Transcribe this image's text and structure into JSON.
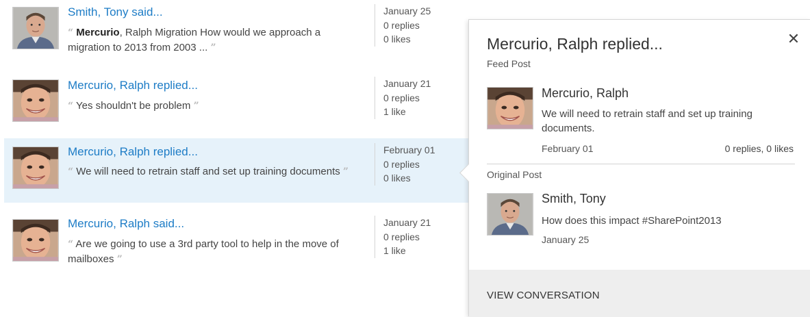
{
  "feed": {
    "items": [
      {
        "title": "Smith, Tony said...",
        "quote_prefix_bold": "Mercurio",
        "quote_text": ", Ralph Migration How would we approach a migration to 2013 from 2003 ...",
        "date": "January 25",
        "replies": "0 replies",
        "likes": "0 likes",
        "avatar": "tony-smith-avatar"
      },
      {
        "title": "Mercurio, Ralph replied...",
        "quote_prefix_bold": "",
        "quote_text": "Yes shouldn't be problem",
        "date": "January 21",
        "replies": "0 replies",
        "likes": "1 like",
        "avatar": "ralph-mercurio-avatar"
      },
      {
        "title": "Mercurio, Ralph replied...",
        "quote_prefix_bold": "",
        "quote_text": "We will need to retrain staff and set up training documents",
        "date": "February 01",
        "replies": "0 replies",
        "likes": "0 likes",
        "avatar": "ralph-mercurio-avatar",
        "selected": true
      },
      {
        "title": "Mercurio, Ralph said...",
        "quote_prefix_bold": "",
        "quote_text": "Are we going to use a 3rd party tool to help in the move of mailboxes",
        "date": "January 21",
        "replies": "0 replies",
        "likes": "1 like",
        "avatar": "ralph-mercurio-avatar"
      }
    ],
    "quote_open": "“",
    "quote_close": "”"
  },
  "popup": {
    "title": "Mercurio, Ralph replied...",
    "close_glyph": "✕",
    "feed_post_label": "Feed Post",
    "feed_post": {
      "author": "Mercurio, Ralph",
      "text": "We will need to retrain staff and set up training documents.",
      "date": "February 01",
      "stats": "0 replies, 0 likes"
    },
    "original_post_label": "Original Post",
    "original_post": {
      "author": "Smith, Tony",
      "text": "How does this impact #SharePoint2013",
      "date": "January 25"
    },
    "footer_label": "VIEW CONVERSATION"
  },
  "colors": {
    "link": "#1d7cc6",
    "selected_row": "#e6f2fa",
    "footer_bg": "#eeeeee"
  }
}
